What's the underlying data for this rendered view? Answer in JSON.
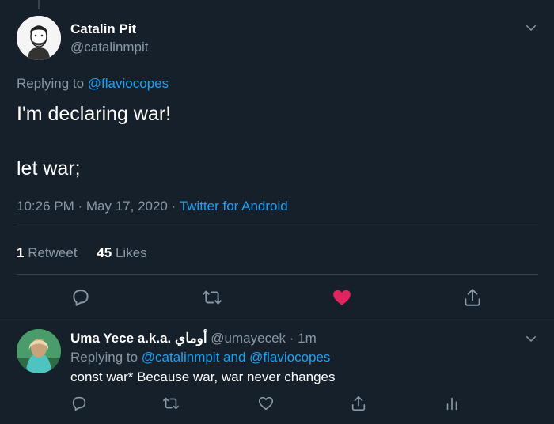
{
  "main_tweet": {
    "author_name": "Catalin Pit",
    "author_handle": "@catalinmpit",
    "replying_prefix": "Replying to",
    "replying_to": "@flaviocopes",
    "line1": "I'm declaring war!",
    "line2": "let war;",
    "timestamp": "10:26 PM · May 17, 2020 ·",
    "source": "Twitter for Android",
    "retweet_count": "1",
    "retweet_label": "Retweet",
    "like_count": "45",
    "like_label": "Likes"
  },
  "reply_tweet": {
    "author_name": "Uma Yece a.k.a. أوماي",
    "author_handle": "@umayecek",
    "time": "· 1m",
    "replying_prefix": "Replying to",
    "replying_to": "@catalinmpit and @flaviocopes",
    "text": "const war* Because war, war never changes"
  },
  "colors": {
    "background": "#15202b",
    "accent": "#1da1f2",
    "muted": "#8899a6",
    "like": "#e0245e",
    "divider": "#38444d"
  },
  "icons": [
    "chevron-down-icon",
    "reply-icon",
    "retweet-icon",
    "heart-icon",
    "share-icon",
    "analytics-icon"
  ]
}
